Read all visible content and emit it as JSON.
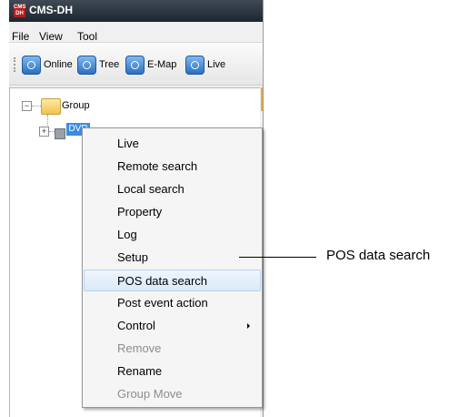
{
  "window": {
    "title": "CMS-DH",
    "icon_text": "CMS DH"
  },
  "menubar": {
    "items": [
      "File",
      "View",
      "Tool"
    ]
  },
  "toolbar": {
    "buttons": [
      {
        "label": "Online",
        "icon": "power-icon"
      },
      {
        "label": "Tree",
        "icon": "tree-icon"
      },
      {
        "label": "E-Map",
        "icon": "emap-icon"
      },
      {
        "label": "Live",
        "icon": "live-icon"
      }
    ]
  },
  "tree": {
    "root": {
      "label": "Group",
      "expander": "−"
    },
    "device": {
      "label": "DVR",
      "expander": "+"
    }
  },
  "context_menu": {
    "items": [
      {
        "label": "Live",
        "enabled": true
      },
      {
        "label": "Remote search",
        "enabled": true
      },
      {
        "label": "Local search",
        "enabled": true
      },
      {
        "label": "Property",
        "enabled": true
      },
      {
        "label": "Log",
        "enabled": true
      },
      {
        "label": "Setup",
        "enabled": true
      },
      {
        "label": "POS data search",
        "enabled": true,
        "highlighted": true
      },
      {
        "label": "Post event action",
        "enabled": true
      },
      {
        "label": "Control",
        "enabled": true,
        "submenu": true
      },
      {
        "label": "Remove",
        "enabled": false
      },
      {
        "label": "Rename",
        "enabled": true
      },
      {
        "label": "Group Move",
        "enabled": false
      }
    ]
  },
  "callout": {
    "label": "POS data search"
  }
}
